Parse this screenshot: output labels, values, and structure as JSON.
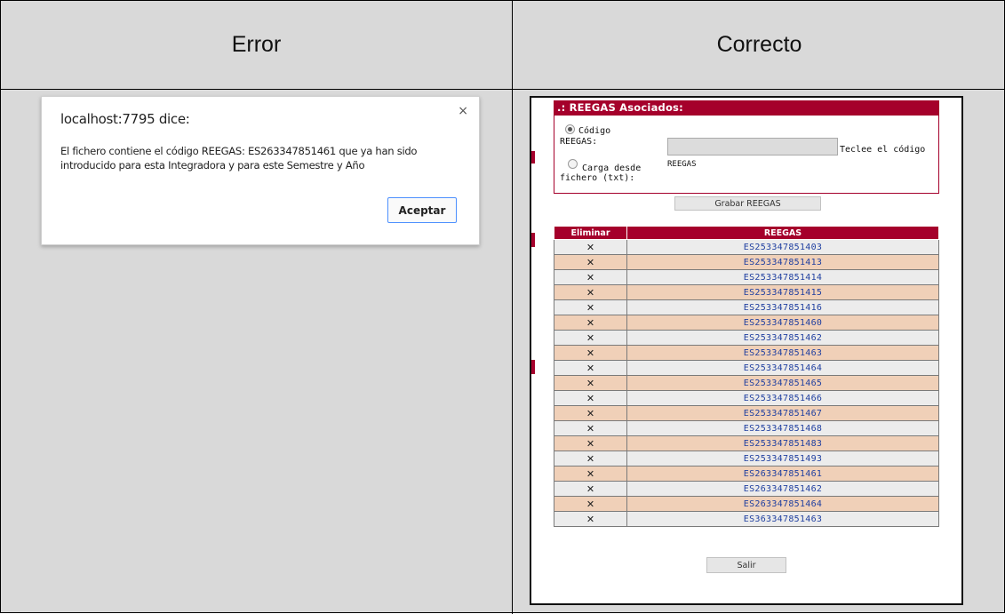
{
  "headers": {
    "error": "Error",
    "correcto": "Correcto"
  },
  "dialog": {
    "title": "localhost:7795 dice:",
    "message": "El fichero contiene el código REEGAS: ES263347851461 que ya han sido introducido para esta Integradora y para este Semestre y Año",
    "close_glyph": "×",
    "ok_label": "Aceptar"
  },
  "panel": {
    "title": ".: REEGAS Asociados:",
    "radio_codigo_line1": "Código",
    "radio_codigo_line2": "REEGAS:",
    "radio_fichero_line1": "Carga desde",
    "radio_fichero_line2": "fichero (txt):",
    "hint_line1": "Teclee el código",
    "hint_line2": "REEGAS",
    "code_value": "",
    "grabar_label": "Grabar REEGAS"
  },
  "table": {
    "col_eliminar": "Eliminar",
    "col_reegas": "REEGAS",
    "delete_glyph": "✕",
    "rows": [
      "ES253347851403",
      "ES253347851413",
      "ES253347851414",
      "ES253347851415",
      "ES253347851416",
      "ES253347851460",
      "ES253347851462",
      "ES253347851463",
      "ES253347851464",
      "ES253347851465",
      "ES253347851466",
      "ES253347851467",
      "ES253347851468",
      "ES253347851483",
      "ES253347851493",
      "ES263347851461",
      "ES263347851462",
      "ES263347851464",
      "ES363347851463"
    ]
  },
  "salir_label": "Salir",
  "colors": {
    "accent": "#a5002b",
    "row_odd": "#ececec",
    "row_even": "#f0d0b8",
    "link": "#1f3fa0"
  }
}
